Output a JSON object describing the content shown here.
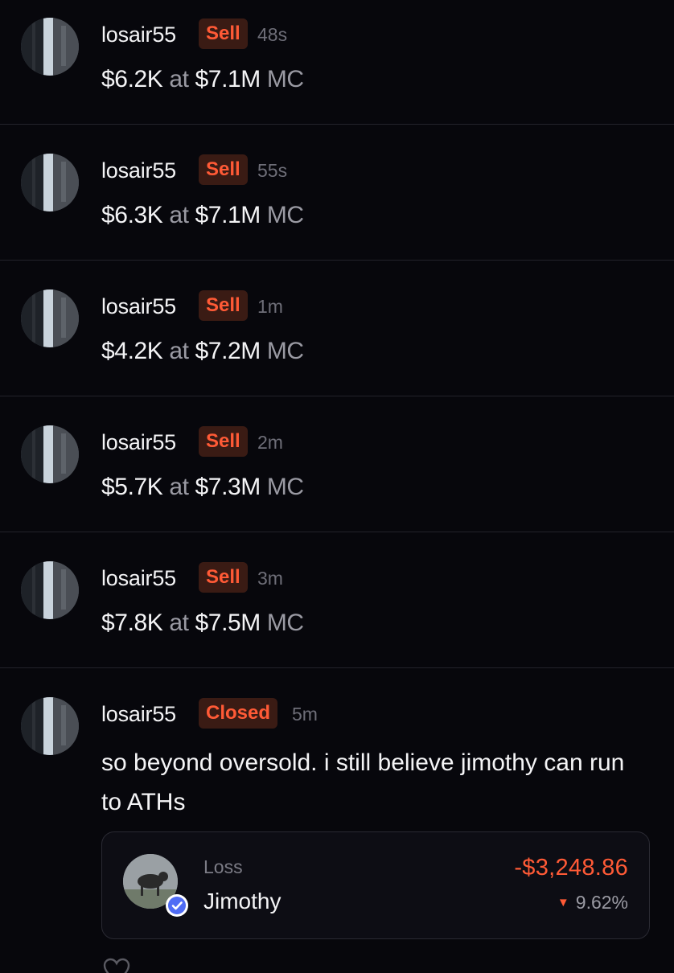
{
  "trades": [
    {
      "username": "losair55",
      "action": "Sell",
      "time": "48s",
      "amount": "$6.2K",
      "at": "at",
      "price": "$7.1M",
      "unit": "MC"
    },
    {
      "username": "losair55",
      "action": "Sell",
      "time": "55s",
      "amount": "$6.3K",
      "at": "at",
      "price": "$7.1M",
      "unit": "MC"
    },
    {
      "username": "losair55",
      "action": "Sell",
      "time": "1m",
      "amount": "$4.2K",
      "at": "at",
      "price": "$7.2M",
      "unit": "MC"
    },
    {
      "username": "losair55",
      "action": "Sell",
      "time": "2m",
      "amount": "$5.7K",
      "at": "at",
      "price": "$7.3M",
      "unit": "MC"
    },
    {
      "username": "losair55",
      "action": "Sell",
      "time": "3m",
      "amount": "$7.8K",
      "at": "at",
      "price": "$7.5M",
      "unit": "MC"
    }
  ],
  "post": {
    "username": "losair55",
    "action": "Closed",
    "time": "5m",
    "message": "so beyond oversold. i still believe jimothy can run to ATHs",
    "card": {
      "label": "Loss",
      "token": "Jimothy",
      "amount": "-$3,248.86",
      "percent": "9.62%"
    }
  },
  "colors": {
    "background": "#07070c",
    "accent_red": "#ff5a36",
    "badge_bg": "#3a1b14",
    "verified_blue": "#4f6cf5"
  },
  "icons": {
    "avatar": "user-avatar-photo",
    "token": "jimothy-token-image",
    "verified": "verified-check-icon",
    "trend": "down-triangle-icon",
    "like": "heart-icon"
  }
}
